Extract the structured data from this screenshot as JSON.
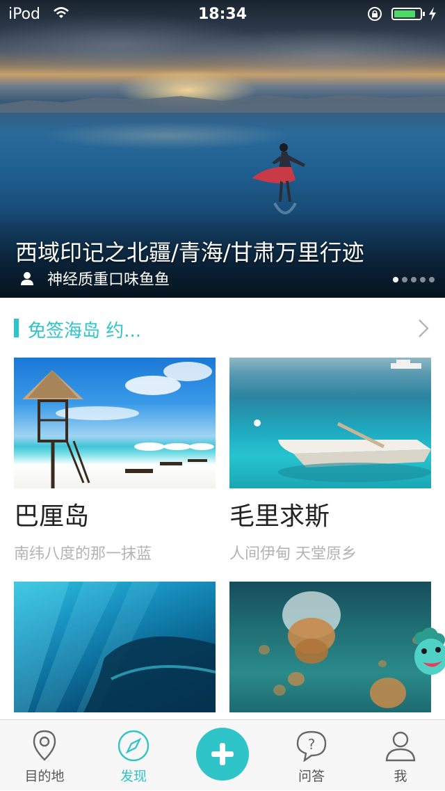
{
  "status_bar": {
    "carrier": "iPod",
    "time": "18:34",
    "battery_level": 0.8
  },
  "hero": {
    "title": "西域印记之北疆/青海/甘肃万里行迹",
    "author": "神经质重口味鱼鱼",
    "page_count": 5,
    "active_page": 1
  },
  "section": {
    "title": "免签海岛 约..."
  },
  "cards": [
    {
      "name": "巴厘岛",
      "desc": "南纬八度的那一抹蓝"
    },
    {
      "name": "毛里求斯",
      "desc": "人间伊甸 天堂原乡"
    },
    {
      "name": "",
      "desc": ""
    },
    {
      "name": "",
      "desc": ""
    }
  ],
  "tabbar": {
    "accent_color": "#2ec4c8",
    "items": [
      {
        "label": "目的地",
        "icon": "location-pin-icon"
      },
      {
        "label": "发现",
        "icon": "compass-icon",
        "active": true
      },
      {
        "label": "",
        "icon": "plus-icon"
      },
      {
        "label": "问答",
        "icon": "question-bubble-icon"
      },
      {
        "label": "我",
        "icon": "person-icon"
      }
    ]
  }
}
